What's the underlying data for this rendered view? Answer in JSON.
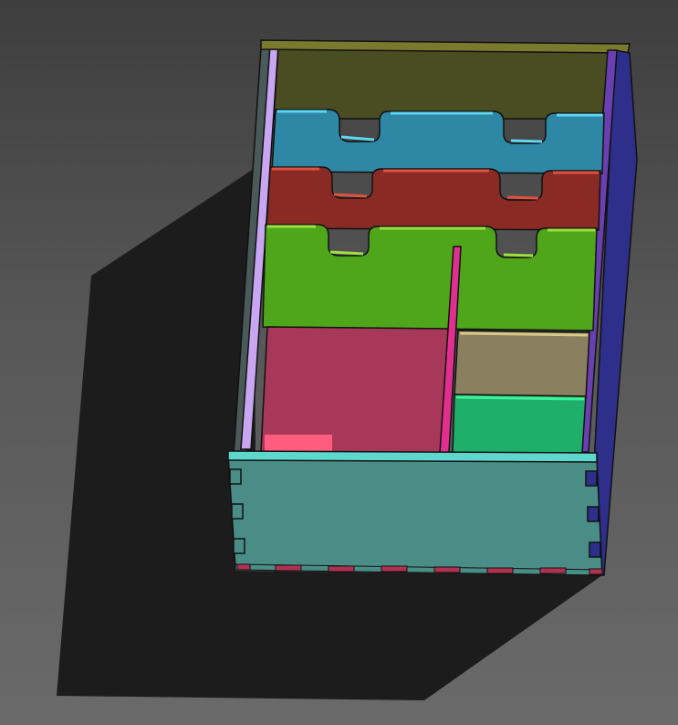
{
  "scene": {
    "description_free": true,
    "colors": {
      "background_top": "#3e3e3e",
      "background_bottom": "#6a6a6a",
      "shadow": "#1c1c1c",
      "back_wall": "#4a4d22",
      "back_wall_top": "#7a7a2e",
      "divider_blue": "#2f87a6",
      "divider_blue_edge": "#5fd6f2",
      "divider_red": "#8a2a24",
      "divider_red_edge": "#e0513f",
      "divider_green": "#4fa61b",
      "divider_green_edge": "#9ee040",
      "left_wall": "#c9a6f2",
      "left_wall_dark": "#495a58",
      "right_wall": "#2d2f8a",
      "right_wall_edge": "#6a3fb0",
      "pink_floor": "#a8385a",
      "pink_highlight": "#ff5c7e",
      "vertical_divider": "#e02f8f",
      "tan_compartment": "#8a7f5e",
      "tan_edge": "#d8c98a",
      "green_compartment": "#1faf6a",
      "green_edge": "#3ff29a",
      "front_wall": "#4a8c86",
      "front_wall_top": "#5ed8cc",
      "tab_blue": "#2d2f8a",
      "bottom_strip": "#b03250"
    }
  }
}
